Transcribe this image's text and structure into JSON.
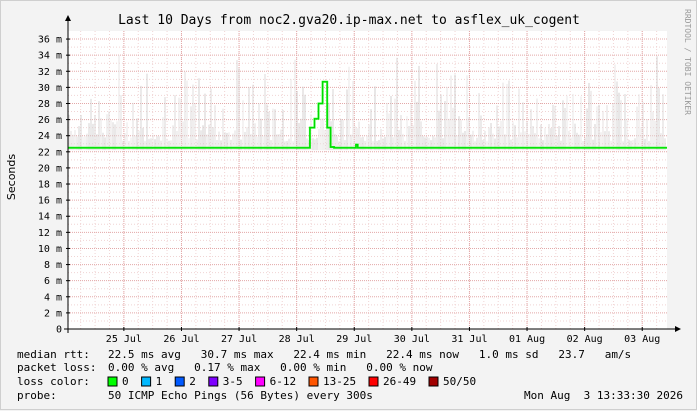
{
  "chart_data": {
    "type": "line",
    "title": "Last 10 Days from noc2.gva20.ip-max.net to asflex_uk_cogent",
    "ylabel": "Seconds",
    "ylim": [
      0,
      37
    ],
    "y_ticks": [
      0,
      2,
      4,
      6,
      8,
      10,
      12,
      14,
      16,
      18,
      20,
      22,
      24,
      26,
      28,
      30,
      32,
      34,
      36
    ],
    "y_tick_labels": [
      "0",
      "2 m",
      "4 m",
      "6 m",
      "8 m",
      "10 m",
      "12 m",
      "14 m",
      "16 m",
      "18 m",
      "20 m",
      "22 m",
      "24 m",
      "26 m",
      "28 m",
      "30 m",
      "32 m",
      "34 m",
      "36 m"
    ],
    "x_range_days": [
      0,
      10.4
    ],
    "x_ticks": [
      {
        "day": 0.97,
        "label": "25 Jul"
      },
      {
        "day": 1.97,
        "label": "26 Jul"
      },
      {
        "day": 2.97,
        "label": "27 Jul"
      },
      {
        "day": 3.97,
        "label": "28 Jul"
      },
      {
        "day": 4.97,
        "label": "29 Jul"
      },
      {
        "day": 5.97,
        "label": "30 Jul"
      },
      {
        "day": 6.97,
        "label": "31 Jul"
      },
      {
        "day": 7.97,
        "label": "01 Aug"
      },
      {
        "day": 8.97,
        "label": "02 Aug"
      },
      {
        "day": 9.97,
        "label": "03 Aug"
      }
    ],
    "grid": true,
    "series": [
      {
        "name": "0",
        "color": "#00ff00",
        "x": [
          0,
          4.2,
          4.2,
          4.28,
          4.28,
          4.35,
          4.35,
          4.42,
          4.42,
          4.5,
          4.5,
          4.56,
          4.56,
          4.62,
          4.62,
          5.0,
          5.0,
          5.03,
          5.03,
          10.4
        ],
        "y": [
          22.5,
          22.5,
          25.0,
          25.0,
          26.1,
          26.1,
          28.0,
          28.0,
          30.7,
          30.7,
          25.0,
          25.0,
          22.6,
          22.6,
          22.5,
          22.5,
          22.9,
          22.9,
          22.5,
          22.5
        ]
      }
    ],
    "smoke_range_ms": [
      22.0,
      30.0
    ],
    "watermark": "RRDTOOL / TOBI OETIKER",
    "stats": {
      "median_rtt_label": "median rtt:",
      "median_rtt_values": "22.5 ms avg   30.7 ms max   22.4 ms min   22.4 ms now   1.0 ms sd   23.7   am/s",
      "packet_loss_label": "packet loss:",
      "packet_loss_values": "0.00 % avg   0.17 % max   0.00 % min   0.00 % now",
      "loss_color_label": "loss color:",
      "loss_colors": [
        {
          "label": "0",
          "color": "#00ff00"
        },
        {
          "label": "1",
          "color": "#00b8ff"
        },
        {
          "label": "2",
          "color": "#0059ff"
        },
        {
          "label": "3-5",
          "color": "#7e00ff"
        },
        {
          "label": "6-12",
          "color": "#ff00ff"
        },
        {
          "label": "13-25",
          "color": "#ff5500"
        },
        {
          "label": "26-49",
          "color": "#ff0000"
        },
        {
          "label": "50/50",
          "color": "#a10000"
        }
      ],
      "probe_label": "probe:",
      "probe_value": "50 ICMP Echo Pings (56 Bytes) every 300s",
      "timestamp": "Mon Aug  3 13:33:30 2026"
    }
  }
}
